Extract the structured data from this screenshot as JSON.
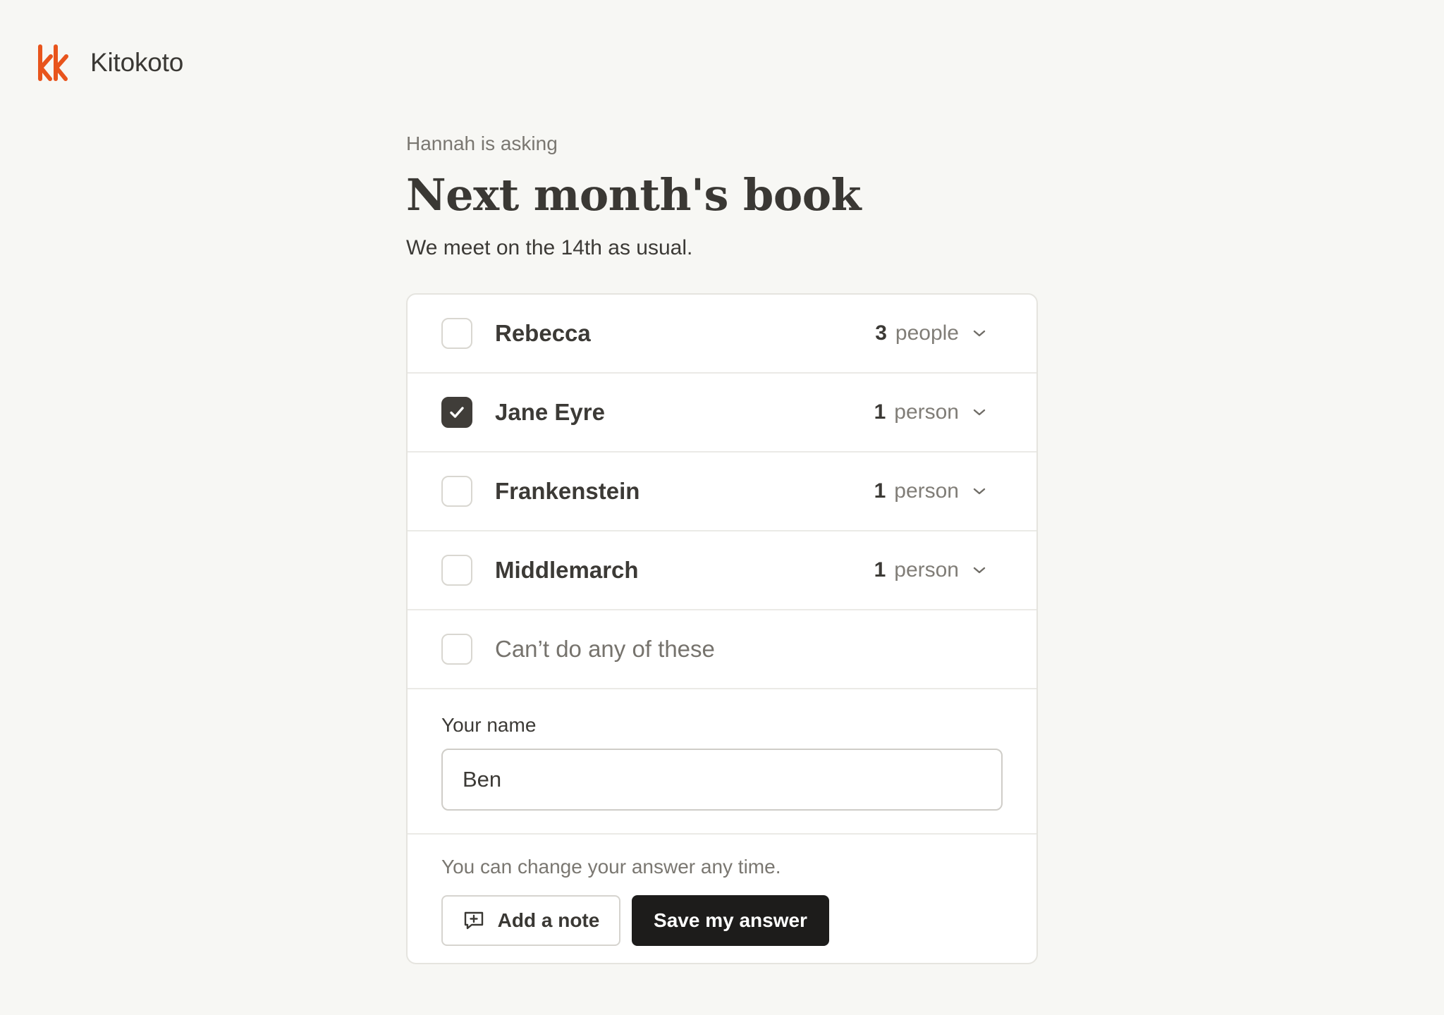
{
  "app": {
    "name": "Kitokoto",
    "logo_icon": "kk-logo-icon",
    "accent_color": "#e8541c"
  },
  "poll": {
    "asker": "Hannah is asking",
    "title": "Next month's book",
    "description": "We meet on the 14th as usual."
  },
  "options": [
    {
      "label": "Rebecca",
      "checked": false,
      "count": "3",
      "count_label": "people"
    },
    {
      "label": "Jane Eyre",
      "checked": true,
      "count": "1",
      "count_label": "person"
    },
    {
      "label": "Frankenstein",
      "checked": false,
      "count": "1",
      "count_label": "person"
    },
    {
      "label": "Middlemarch",
      "checked": false,
      "count": "1",
      "count_label": "person"
    }
  ],
  "none_option": {
    "label": "Can’t do any of these",
    "checked": false
  },
  "name_field": {
    "label": "Your name",
    "value": "Ben"
  },
  "footer": {
    "note": "You can change your answer any time.",
    "add_note_label": "Add a note",
    "add_note_icon": "add-comment-icon",
    "save_label": "Save my answer"
  }
}
